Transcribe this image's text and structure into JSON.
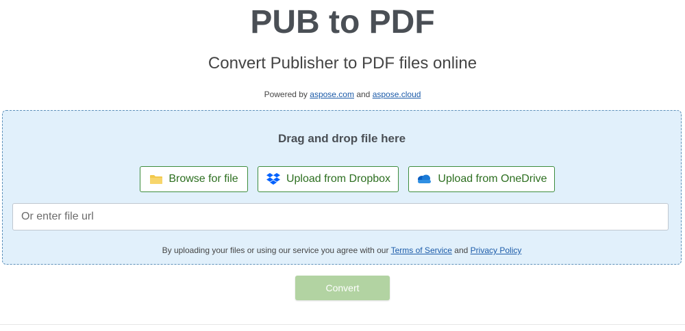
{
  "header": {
    "title": "PUB to PDF",
    "subtitle": "Convert Publisher to PDF files online"
  },
  "powered": {
    "prefix": "Powered by",
    "link1": "aspose.com",
    "and": "and",
    "link2": "aspose.cloud"
  },
  "dropzone": {
    "drag_text": "Drag and drop file here",
    "buttons": {
      "browse": {
        "label": "Browse for file",
        "icon": "folder-icon"
      },
      "dropbox": {
        "label": "Upload from Dropbox",
        "icon": "dropbox-icon"
      },
      "onedrive": {
        "label": "Upload from OneDrive",
        "icon": "onedrive-icon"
      }
    },
    "url_placeholder": "Or enter file url",
    "agreement": {
      "prefix": "By uploading your files or using our service you agree with our",
      "terms": "Terms of Service",
      "and": "and",
      "privacy": "Privacy Policy"
    }
  },
  "convert": {
    "label": "Convert"
  },
  "colors": {
    "dropzone_bg": "#e1f0fb",
    "button_border": "#3b8b3b",
    "convert_disabled": "#b2d3a2",
    "link": "#1a5aa8"
  }
}
